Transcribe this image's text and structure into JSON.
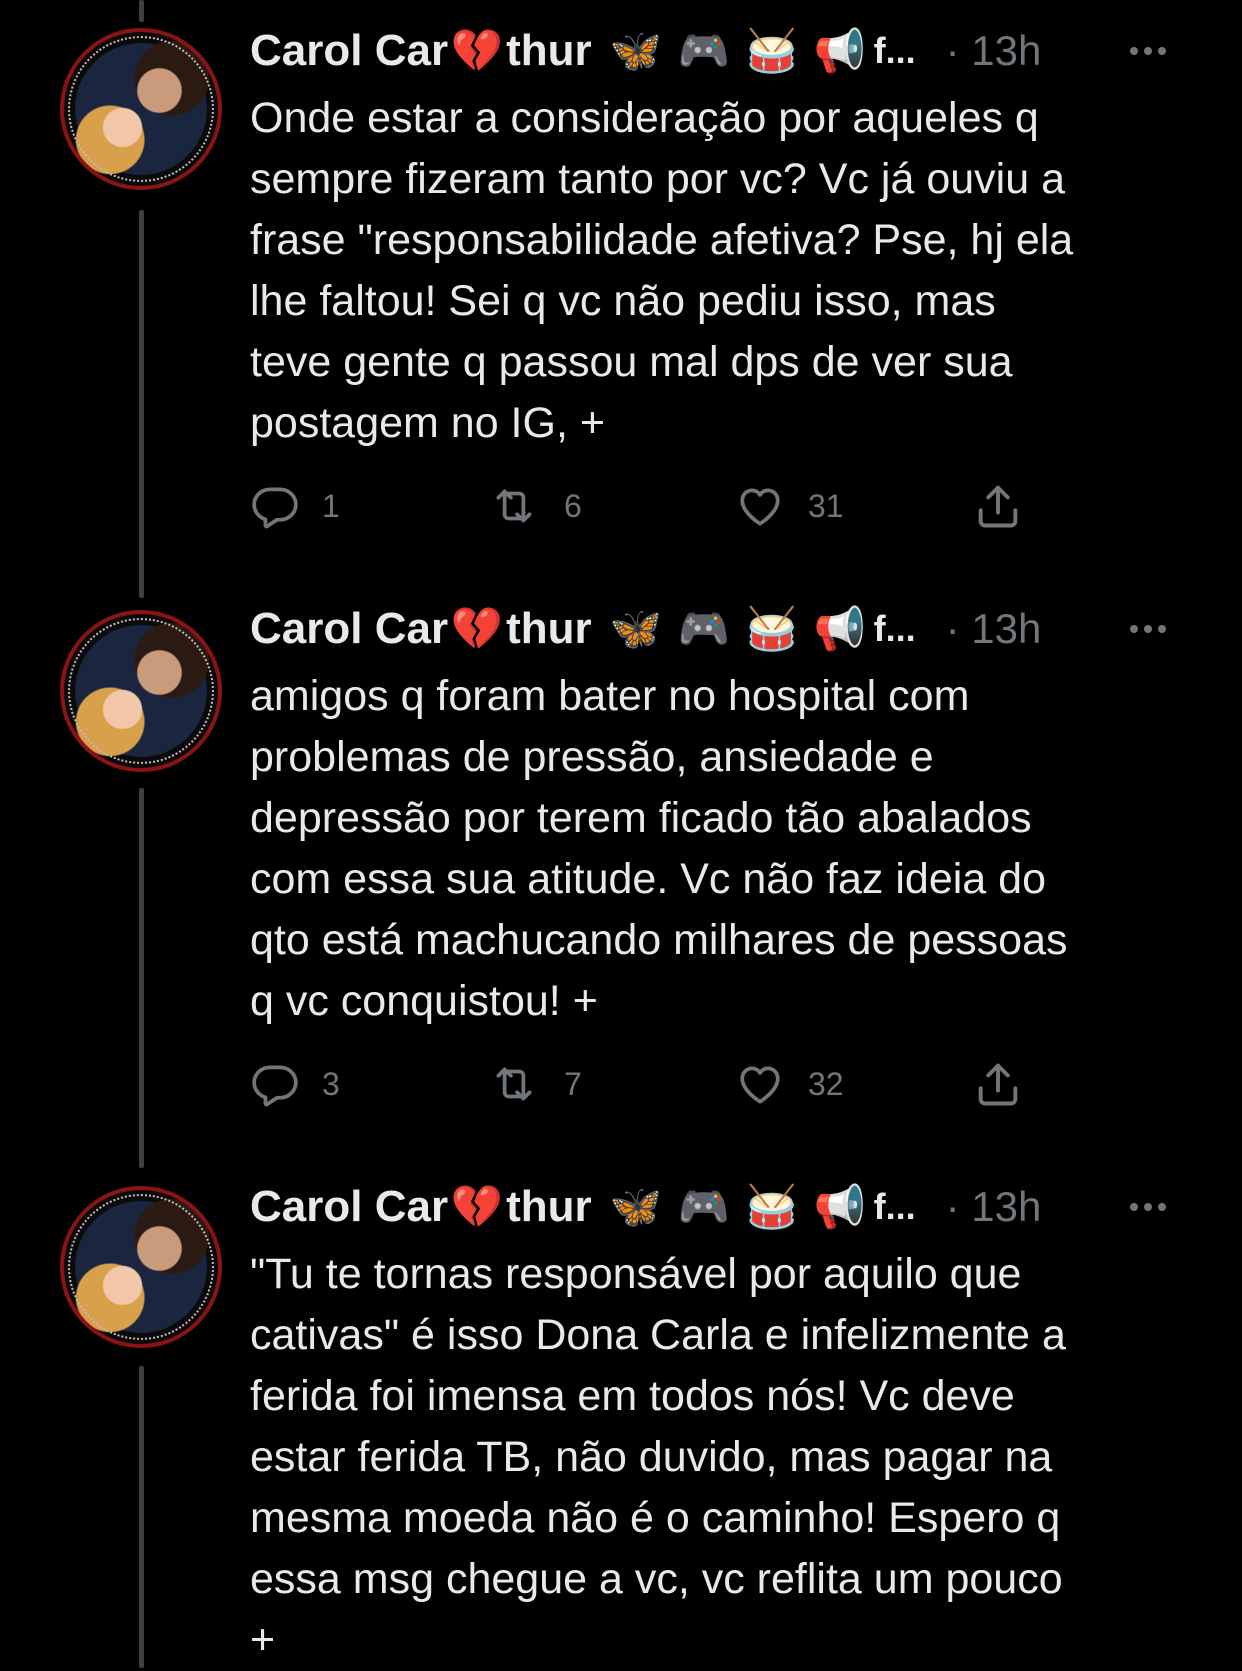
{
  "tweets": [
    {
      "author_name_start": "Carol Car",
      "author_name_heart": "💔",
      "author_name_end": "thur",
      "badges": [
        "🦋",
        "🎮",
        "🥁",
        "📢"
      ],
      "truncation": "f...",
      "time": "· 13h",
      "text": "Onde estar a consideração por aqueles q\nsempre fizeram tanto por vc? Vc já ouviu a\nfrase \"responsabilidade afetiva? Pse, hj ela\nlhe faltou! Sei q vc não pediu isso, mas\nteve gente q passou mal dps de ver sua\npostagem no IG, +",
      "replies": "1",
      "retweets": "6",
      "likes": "31"
    },
    {
      "author_name_start": "Carol Car",
      "author_name_heart": "💔",
      "author_name_end": "thur",
      "badges": [
        "🦋",
        "🎮",
        "🥁",
        "📢"
      ],
      "truncation": "f...",
      "time": "· 13h",
      "text": "amigos q foram bater no hospital com\nproblemas de pressão, ansiedade e\ndepressão por terem ficado tão abalados\ncom essa sua atitude. Vc não faz ideia do\nqto está machucando milhares de pessoas\nq vc conquistou! +",
      "replies": "3",
      "retweets": "7",
      "likes": "32"
    },
    {
      "author_name_start": "Carol Car",
      "author_name_heart": "💔",
      "author_name_end": "thur",
      "badges": [
        "🦋",
        "🎮",
        "🥁",
        "📢"
      ],
      "truncation": "f...",
      "time": "· 13h",
      "text": "\"Tu te tornas responsável por aquilo que\ncativas\" é isso Dona Carla e infelizmente a\nferida foi imensa em todos nós! Vc deve\nestar ferida TB, não duvido, mas pagar na\nmesma moeda não é o caminho! Espero q\nessa msg chegue a vc, vc reflita um pouco\n+"
    }
  ],
  "icons": {
    "reply": "reply-icon",
    "retweet": "retweet-icon",
    "like": "heart-icon",
    "share": "share-icon",
    "more": "more-icon"
  },
  "colors": {
    "background": "#000000",
    "text": "#e7e9ea",
    "muted": "#71767b",
    "thread_line": "#3e4144"
  }
}
